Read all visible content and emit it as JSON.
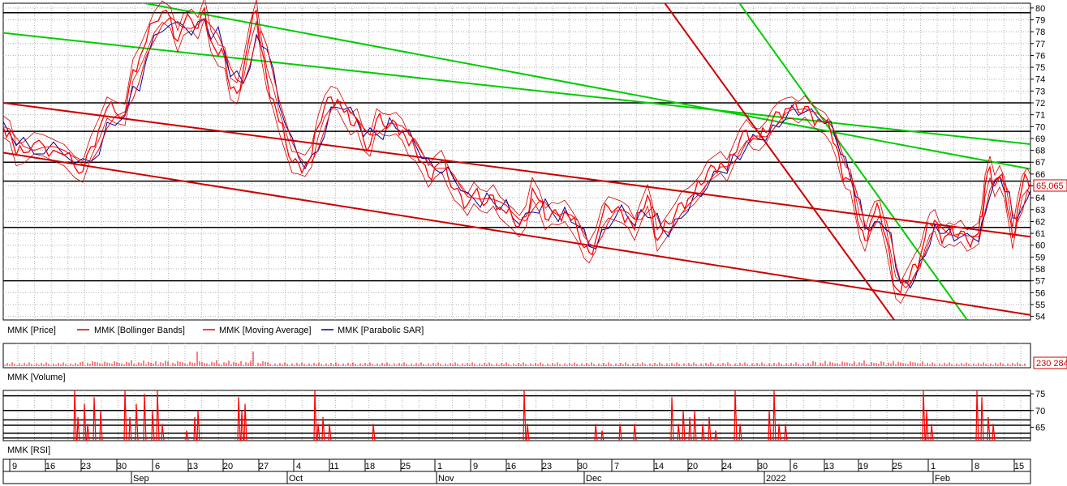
{
  "chart_data": [
    {
      "type": "line",
      "panel": "price",
      "legend": [
        "MMK [Price]",
        "MMK [Bollinger Bands]",
        "MMK [Moving Average]",
        "MMK [Parabolic SAR]"
      ],
      "y_ticks": [
        54,
        55,
        56,
        57,
        58,
        59,
        60,
        61,
        62,
        63,
        64,
        65,
        66,
        67,
        68,
        69,
        70,
        71,
        72,
        73,
        74,
        75,
        76,
        77,
        78,
        79,
        80
      ],
      "ylim": [
        53.7,
        80.4
      ],
      "last_value": "65,065",
      "horizontal_levels": [
        79.6,
        72.0,
        69.6,
        67.0,
        65.4,
        61.5,
        57.0
      ],
      "price_series": [
        [
          0,
          70
        ],
        [
          8,
          69.6
        ],
        [
          16,
          67.6
        ],
        [
          25,
          67.8
        ],
        [
          38,
          68.6
        ],
        [
          50,
          68.4
        ],
        [
          62,
          68.0
        ],
        [
          75,
          67.6
        ],
        [
          88,
          66.6
        ],
        [
          98,
          66.2
        ],
        [
          108,
          68.3
        ],
        [
          118,
          69.8
        ],
        [
          128,
          71.6
        ],
        [
          138,
          71.2
        ],
        [
          150,
          71.0
        ],
        [
          160,
          74.8
        ],
        [
          168,
          75.8
        ],
        [
          176,
          77.1
        ],
        [
          186,
          78.8
        ],
        [
          196,
          79.7
        ],
        [
          206,
          79.2
        ],
        [
          215,
          77.2
        ],
        [
          222,
          78.6
        ],
        [
          232,
          79.0
        ],
        [
          240,
          78.3
        ],
        [
          248,
          80.0
        ],
        [
          256,
          77.2
        ],
        [
          265,
          76.0
        ],
        [
          273,
          75.8
        ],
        [
          280,
          73.2
        ],
        [
          288,
          72.8
        ],
        [
          296,
          74.9
        ],
        [
          304,
          77.8
        ],
        [
          312,
          79.8
        ],
        [
          318,
          76.6
        ],
        [
          325,
          74.0
        ],
        [
          333,
          72.3
        ],
        [
          340,
          70.4
        ],
        [
          348,
          68.7
        ],
        [
          356,
          67.0
        ],
        [
          364,
          66.9
        ],
        [
          372,
          66.7
        ],
        [
          380,
          67.5
        ],
        [
          388,
          70.0
        ],
        [
          396,
          71.7
        ],
        [
          404,
          72.5
        ],
        [
          412,
          72.3
        ],
        [
          420,
          71.2
        ],
        [
          428,
          70.2
        ],
        [
          436,
          70.6
        ],
        [
          444,
          68.9
        ],
        [
          452,
          68.4
        ],
        [
          460,
          70.6
        ],
        [
          468,
          70.2
        ],
        [
          476,
          70.1
        ],
        [
          484,
          70.3
        ],
        [
          492,
          69.7
        ],
        [
          500,
          68.4
        ],
        [
          508,
          68.0
        ],
        [
          516,
          67.0
        ],
        [
          524,
          65.8
        ],
        [
          532,
          66.6
        ],
        [
          540,
          67.1
        ],
        [
          548,
          65.8
        ],
        [
          556,
          64.7
        ],
        [
          564,
          64.2
        ],
        [
          572,
          63.4
        ],
        [
          580,
          64.4
        ],
        [
          588,
          63.8
        ],
        [
          596,
          63.6
        ],
        [
          604,
          64.2
        ],
        [
          612,
          63.2
        ],
        [
          620,
          62.7
        ],
        [
          628,
          62.2
        ],
        [
          636,
          61.6
        ],
        [
          644,
          62.4
        ],
        [
          652,
          64.8
        ],
        [
          660,
          63.8
        ],
        [
          668,
          62.2
        ],
        [
          676,
          62.7
        ],
        [
          684,
          62.6
        ],
        [
          692,
          62.9
        ],
        [
          700,
          62.1
        ],
        [
          708,
          61.2
        ],
        [
          716,
          59.8
        ],
        [
          722,
          59.4
        ],
        [
          730,
          60.4
        ],
        [
          738,
          62.4
        ],
        [
          746,
          63.2
        ],
        [
          754,
          63.0
        ],
        [
          762,
          62.8
        ],
        [
          770,
          62.4
        ],
        [
          778,
          61.3
        ],
        [
          786,
          62.8
        ],
        [
          794,
          64.2
        ],
        [
          800,
          62.6
        ],
        [
          806,
          60.4
        ],
        [
          812,
          61.0
        ],
        [
          820,
          61.8
        ],
        [
          828,
          62.6
        ],
        [
          836,
          63.6
        ],
        [
          844,
          63.9
        ],
        [
          852,
          64.4
        ],
        [
          860,
          65.1
        ],
        [
          868,
          66.2
        ],
        [
          876,
          66.6
        ],
        [
          884,
          67.0
        ],
        [
          892,
          66.3
        ],
        [
          900,
          67.6
        ],
        [
          908,
          68.9
        ],
        [
          916,
          69.7
        ],
        [
          924,
          69.0
        ],
        [
          932,
          68.9
        ],
        [
          940,
          69.5
        ],
        [
          948,
          70.6
        ],
        [
          956,
          71.2
        ],
        [
          964,
          71.5
        ],
        [
          972,
          71.6
        ],
        [
          980,
          71.2
        ],
        [
          988,
          71.7
        ],
        [
          996,
          71.0
        ],
        [
          1004,
          70.6
        ],
        [
          1012,
          70.3
        ],
        [
          1020,
          69.5
        ],
        [
          1026,
          68.4
        ],
        [
          1032,
          66.7
        ],
        [
          1038,
          65.7
        ],
        [
          1044,
          65.5
        ],
        [
          1050,
          63.4
        ],
        [
          1056,
          61.4
        ],
        [
          1062,
          60.4
        ],
        [
          1068,
          61.8
        ],
        [
          1074,
          62.8
        ],
        [
          1080,
          62.9
        ],
        [
          1088,
          60.6
        ],
        [
          1094,
          58.4
        ],
        [
          1100,
          56.4
        ],
        [
          1106,
          56.0
        ],
        [
          1112,
          56.8
        ],
        [
          1118,
          57.6
        ],
        [
          1124,
          58.4
        ],
        [
          1130,
          59.0
        ],
        [
          1136,
          60.6
        ],
        [
          1142,
          61.8
        ],
        [
          1148,
          62.1
        ],
        [
          1154,
          61.0
        ],
        [
          1160,
          60.7
        ],
        [
          1166,
          61.0
        ],
        [
          1172,
          60.8
        ],
        [
          1180,
          61.2
        ],
        [
          1188,
          60.4
        ],
        [
          1196,
          60.7
        ],
        [
          1202,
          61.0
        ],
        [
          1206,
          62.4
        ],
        [
          1210,
          65.0
        ],
        [
          1216,
          66.6
        ],
        [
          1222,
          65.0
        ],
        [
          1228,
          65.8
        ],
        [
          1234,
          64.8
        ],
        [
          1240,
          62.4
        ],
        [
          1244,
          60.6
        ],
        [
          1250,
          63.0
        ],
        [
          1256,
          65.0
        ],
        [
          1262,
          65.6
        ],
        [
          1266,
          65.06
        ]
      ],
      "trend_lines": [
        {
          "color": "#00cc00",
          "x1": 120,
          "y1": 81.1,
          "x2": 1268,
          "y2": 66.4
        },
        {
          "color": "#00cc00",
          "x1": 0,
          "y1": 77.9,
          "x2": 1268,
          "y2": 68.5
        },
        {
          "color": "#00cc00",
          "x1": 900,
          "y1": 81.1,
          "x2": 1188,
          "y2": 53.7
        },
        {
          "color": "#cc0000",
          "x1": 0,
          "y1": 72.0,
          "x2": 1268,
          "y2": 60.7
        },
        {
          "color": "#cc0000",
          "x1": 0,
          "y1": 67.8,
          "x2": 1268,
          "y2": 54.1
        },
        {
          "color": "#cc0000",
          "x1": 808,
          "y1": 81.1,
          "x2": 1098,
          "y2": 53.7
        }
      ]
    },
    {
      "type": "bar",
      "panel": "volume",
      "legend": [
        "MMK [Volume]"
      ],
      "last_value": "230 284"
    },
    {
      "type": "line",
      "panel": "rsi",
      "legend": [
        "MMK [RSI]"
      ],
      "y_ticks": [
        65,
        70,
        75
      ],
      "ylim": [
        61,
        76
      ],
      "horizontal_levels": [
        74.4,
        70.0,
        67.2,
        65.6,
        63.2,
        61.8
      ],
      "spikes": [
        [
          92,
          76
        ],
        [
          96,
          68
        ],
        [
          104,
          72
        ],
        [
          108,
          66
        ],
        [
          116,
          74
        ],
        [
          124,
          70
        ],
        [
          154,
          76
        ],
        [
          160,
          68
        ],
        [
          168,
          72
        ],
        [
          178,
          75
        ],
        [
          188,
          70
        ],
        [
          194,
          76
        ],
        [
          200,
          66
        ],
        [
          230,
          64
        ],
        [
          240,
          68
        ],
        [
          244,
          70
        ],
        [
          294,
          74
        ],
        [
          298,
          70
        ],
        [
          302,
          72
        ],
        [
          388,
          76
        ],
        [
          392,
          66
        ],
        [
          398,
          68
        ],
        [
          406,
          66
        ],
        [
          460,
          66
        ],
        [
          646,
          76
        ],
        [
          650,
          66
        ],
        [
          734,
          66
        ],
        [
          742,
          64
        ],
        [
          764,
          66
        ],
        [
          782,
          66
        ],
        [
          828,
          74
        ],
        [
          836,
          66
        ],
        [
          842,
          70
        ],
        [
          850,
          68
        ],
        [
          856,
          70
        ],
        [
          866,
          66
        ],
        [
          874,
          68
        ],
        [
          882,
          64
        ],
        [
          906,
          76
        ],
        [
          912,
          66
        ],
        [
          948,
          70
        ],
        [
          954,
          76
        ],
        [
          960,
          66
        ],
        [
          968,
          66
        ],
        [
          1138,
          76
        ],
        [
          1142,
          70
        ],
        [
          1148,
          66
        ],
        [
          1204,
          76
        ],
        [
          1210,
          74
        ],
        [
          1218,
          68
        ],
        [
          1224,
          66
        ]
      ]
    }
  ],
  "x_axis": {
    "days": [
      "9",
      "16",
      "23",
      "30",
      "6",
      "13",
      "20",
      "27",
      "4",
      "11",
      "18",
      "25",
      "1",
      "9",
      "16",
      "23",
      "30",
      "7",
      "14",
      "20",
      "24",
      "30",
      "6",
      "13",
      "19",
      "25",
      "1",
      "8",
      "15"
    ],
    "months": [
      "Sep",
      "Oct",
      "Nov",
      "Dec",
      "2022",
      "Feb"
    ]
  },
  "colors": {
    "price": "#ff0000",
    "bands": "#cc0000",
    "sar": "#000099",
    "green": "#00cc00",
    "grid": "#b0b0b0"
  }
}
